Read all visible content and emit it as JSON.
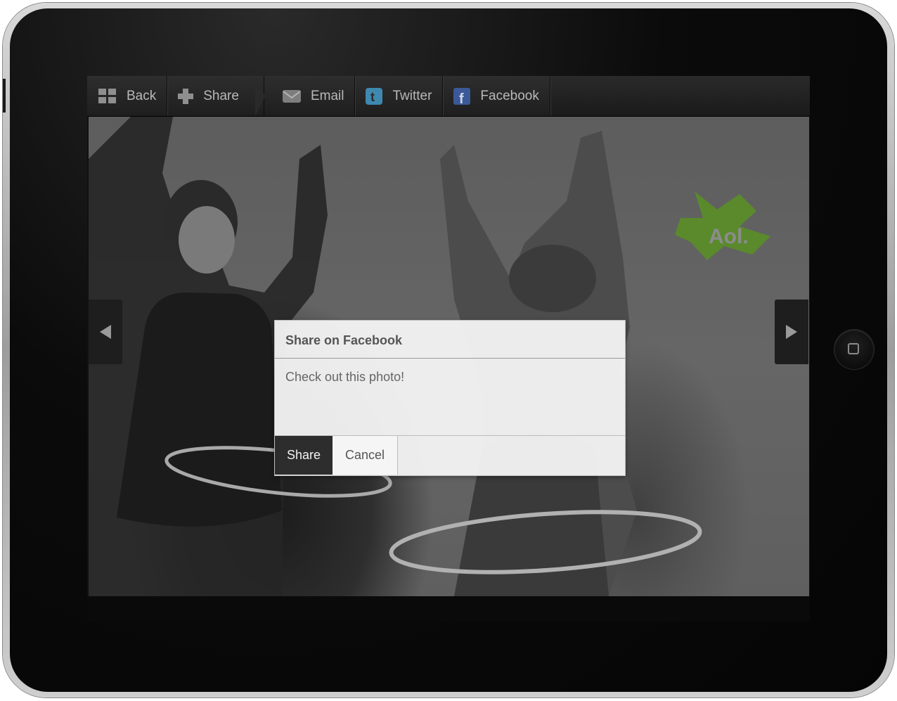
{
  "toolbar": {
    "back_label": "Back",
    "share_label": "Share",
    "email_label": "Email",
    "twitter_label": "Twitter",
    "facebook_label": "Facebook"
  },
  "logo": {
    "text": "Aol."
  },
  "dialog": {
    "title": "Share on Facebook",
    "message": "Check out this photo!",
    "share_button": "Share",
    "cancel_button": "Cancel"
  },
  "colors": {
    "logo_green": "#5a8a2c",
    "toolbar_bg": "#222222",
    "primary_button": "#2d2d2d"
  },
  "icons": {
    "back": "grid-icon",
    "share": "plus-icon",
    "email": "envelope-icon",
    "twitter": "twitter-icon",
    "facebook": "facebook-icon",
    "prev": "triangle-left-icon",
    "next": "triangle-right-icon",
    "home": "home-button-icon"
  }
}
